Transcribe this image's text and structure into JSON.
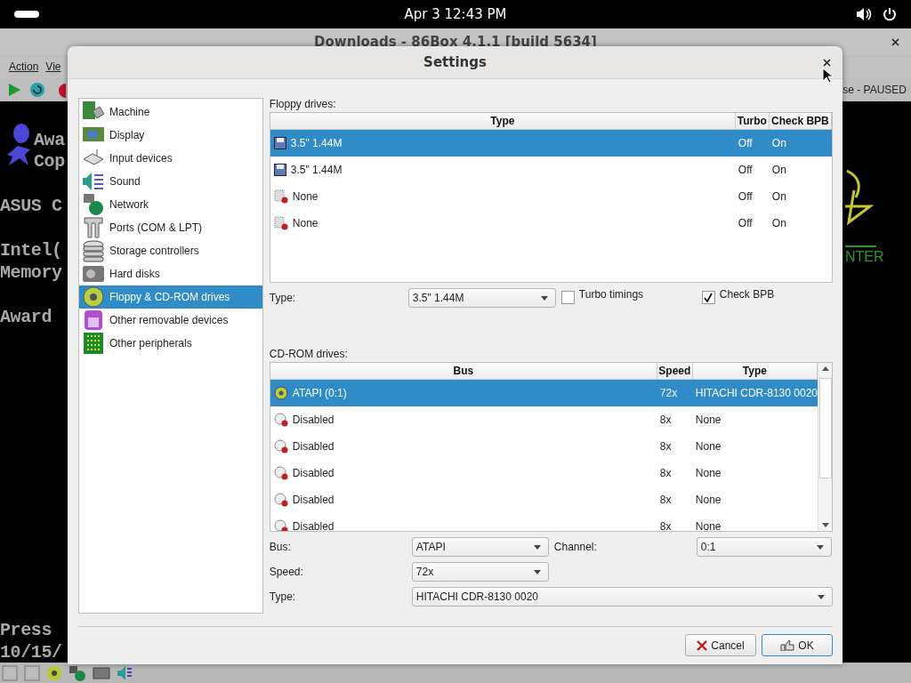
{
  "top_bar": {
    "clock": "Apr 3  12:43 PM"
  },
  "main_window": {
    "title": "Downloads - 86Box 4.1.1 [build 5634]",
    "menu": [
      "Action",
      "Vie"
    ],
    "status": "se - PAUSED",
    "screen_left_lines": [
      "Awa",
      "Cop",
      "ASUS C",
      "Intel(",
      "Memory",
      "Award",
      "Press",
      "10/15/"
    ],
    "screen_right_text": "NTER"
  },
  "dialog": {
    "title": "Settings",
    "sidebar": [
      {
        "label": "Machine",
        "selected": false
      },
      {
        "label": "Display",
        "selected": false
      },
      {
        "label": "Input devices",
        "selected": false
      },
      {
        "label": "Sound",
        "selected": false
      },
      {
        "label": "Network",
        "selected": false
      },
      {
        "label": "Ports (COM & LPT)",
        "selected": false
      },
      {
        "label": "Storage controllers",
        "selected": false
      },
      {
        "label": "Hard disks",
        "selected": false
      },
      {
        "label": "Floppy & CD-ROM drives",
        "selected": true
      },
      {
        "label": "Other removable devices",
        "selected": false
      },
      {
        "label": "Other peripherals",
        "selected": false
      }
    ],
    "floppy": {
      "label": "Floppy drives:",
      "columns": [
        "Type",
        "Turbo",
        "Check BPB"
      ],
      "rows": [
        {
          "kind": "floppy",
          "type": "3.5\" 1.44M",
          "turbo": "Off",
          "check_bpb": "On",
          "selected": true
        },
        {
          "kind": "floppy",
          "type": "3.5\" 1.44M",
          "turbo": "Off",
          "check_bpb": "On",
          "selected": false
        },
        {
          "kind": "none",
          "type": "None",
          "turbo": "Off",
          "check_bpb": "On",
          "selected": false
        },
        {
          "kind": "none",
          "type": "None",
          "turbo": "Off",
          "check_bpb": "On",
          "selected": false
        }
      ],
      "type_label": "Type:",
      "type_value": "3.5\" 1.44M",
      "turbo_label": "Turbo timings",
      "turbo_checked": false,
      "bpb_label": "Check BPB",
      "bpb_checked": true
    },
    "cdrom": {
      "label": "CD-ROM drives:",
      "columns": [
        "Bus",
        "Speed",
        "Type"
      ],
      "rows": [
        {
          "kind": "cd",
          "bus": "ATAPI (0:1)",
          "speed": "72x",
          "type": "HITACHI CDR-8130 0020",
          "selected": true
        },
        {
          "kind": "disabled",
          "bus": "Disabled",
          "speed": "8x",
          "type": "None",
          "selected": false
        },
        {
          "kind": "disabled",
          "bus": "Disabled",
          "speed": "8x",
          "type": "None",
          "selected": false
        },
        {
          "kind": "disabled",
          "bus": "Disabled",
          "speed": "8x",
          "type": "None",
          "selected": false
        },
        {
          "kind": "disabled",
          "bus": "Disabled",
          "speed": "8x",
          "type": "None",
          "selected": false
        },
        {
          "kind": "disabled",
          "bus": "Disabled",
          "speed": "8x",
          "type": "None",
          "selected": false
        }
      ],
      "bus_label": "Bus:",
      "bus_value": "ATAPI",
      "channel_label": "Channel:",
      "channel_value": "0:1",
      "speed_label": "Speed:",
      "speed_value": "72x",
      "type_label": "Type:",
      "type_value": "HITACHI CDR-8130 0020"
    },
    "buttons": [
      {
        "kind": "cancel",
        "label": "Cancel"
      },
      {
        "kind": "ok",
        "label": "OK"
      }
    ]
  }
}
